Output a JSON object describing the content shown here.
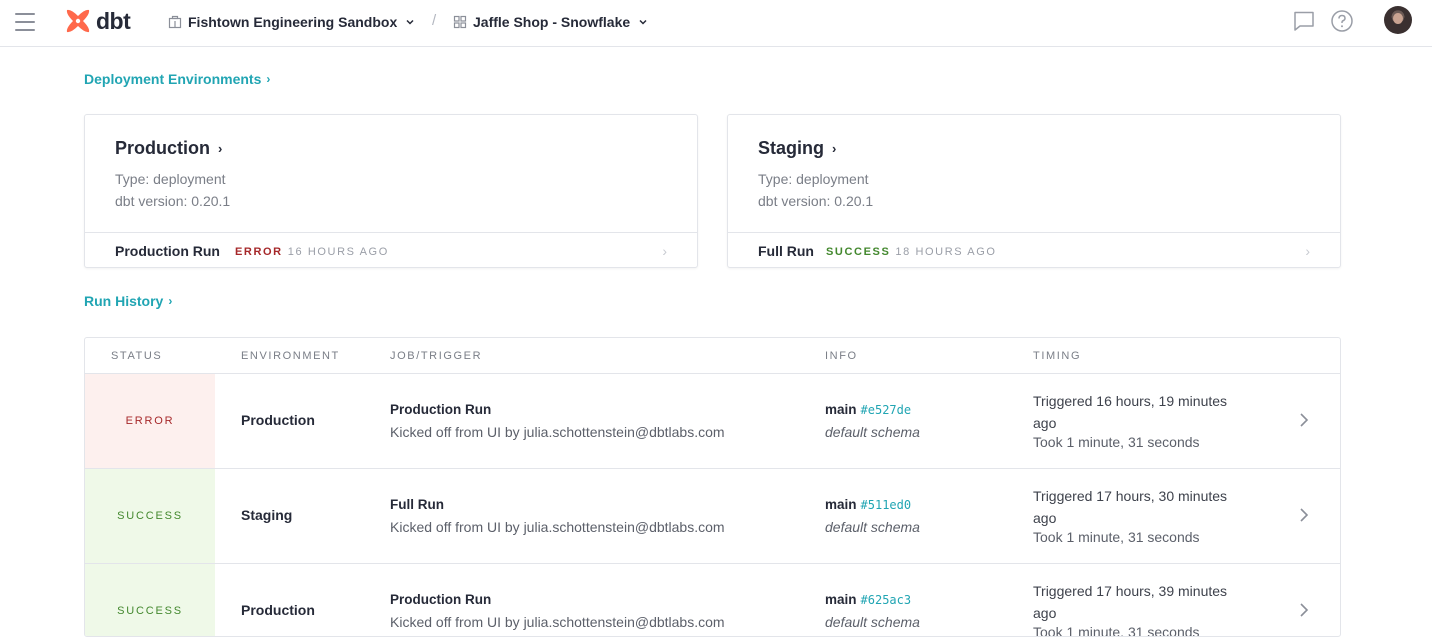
{
  "header": {
    "logo_text": "dbt",
    "account": "Fishtown Engineering Sandbox",
    "separator": "/",
    "project": "Jaffle Shop - Snowflake",
    "icons": [
      "menu-icon",
      "chat-icon",
      "help-icon"
    ]
  },
  "sections": {
    "environments_link": "Deployment Environments",
    "run_history_link": "Run History",
    "arrow": "›"
  },
  "environments": [
    {
      "name": "Production",
      "type": "Type: deployment",
      "version": "dbt version: 0.20.1",
      "last_job": "Production Run",
      "status": "ERROR",
      "ago": "16 HOURS AGO",
      "status_color": "#a6282a"
    },
    {
      "name": "Staging",
      "type": "Type: deployment",
      "version": "dbt version: 0.20.1",
      "last_job": "Full Run",
      "status": "SUCCESS",
      "ago": "18 HOURS AGO",
      "status_color": "#43882e"
    }
  ],
  "run_table": {
    "columns": [
      "STATUS",
      "ENVIRONMENT",
      "JOB/TRIGGER",
      "INFO",
      "TIMING"
    ],
    "rows": [
      {
        "status": "ERROR",
        "environment": "Production",
        "job": "Production Run",
        "trigger": "Kicked off from UI by julia.schottenstein@dbtlabs.com",
        "branch": "main",
        "sha": "#e527de",
        "schema": "default schema",
        "triggered": "Triggered 16 hours, 19 minutes ago",
        "took": "Took 1 minute, 31 seconds"
      },
      {
        "status": "SUCCESS",
        "environment": "Staging",
        "job": "Full Run",
        "trigger": "Kicked off from UI by julia.schottenstein@dbtlabs.com",
        "branch": "main",
        "sha": "#511ed0",
        "schema": "default schema",
        "triggered": "Triggered 17 hours, 30 minutes ago",
        "took": "Took 1 minute, 31 seconds"
      },
      {
        "status": "SUCCESS",
        "environment": "Production",
        "job": "Production Run",
        "trigger": "Kicked off from UI by julia.schottenstein@dbtlabs.com",
        "branch": "main",
        "sha": "#625ac3",
        "schema": "default schema",
        "triggered": "Triggered 17 hours, 39 minutes ago",
        "took": "Took 1 minute, 31 seconds"
      }
    ]
  },
  "colors": {
    "accent": "#21a5b3",
    "logo": "#ff694b",
    "error": "#a6282a",
    "success": "#43882e"
  }
}
